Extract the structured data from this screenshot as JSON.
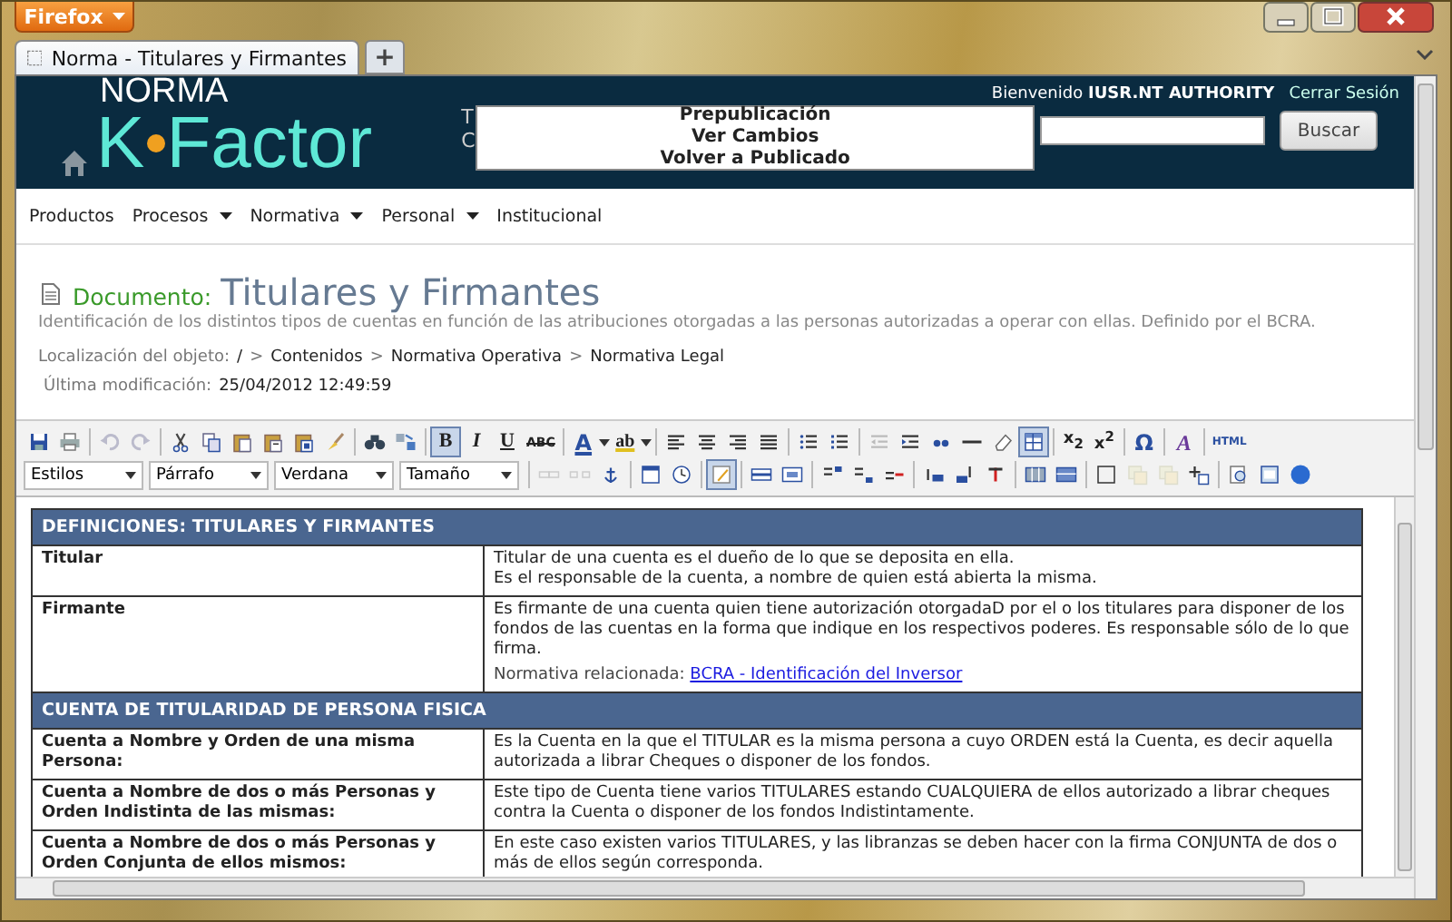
{
  "browser": {
    "menu_button": "Firefox",
    "tab_title": "Norma - Titulares y Firmantes",
    "new_tab": "+"
  },
  "header": {
    "logo_top": "NORMA",
    "logo_k": "K",
    "logo_rest": "Factor",
    "blurb": [
      "T",
      "C"
    ],
    "welcome": "Bienvenido",
    "user": "IUSR.NT AUTHORITY",
    "logout": "Cerrar Sesión",
    "search_button": "Buscar"
  },
  "popup": [
    "Prepublicación",
    "Ver Cambios",
    "Volver a Publicado"
  ],
  "nav": [
    {
      "label": "Productos",
      "has_menu": false
    },
    {
      "label": "Procesos",
      "has_menu": true
    },
    {
      "label": "Normativa",
      "has_menu": true
    },
    {
      "label": "Personal",
      "has_menu": true
    },
    {
      "label": "Institucional",
      "has_menu": false
    }
  ],
  "document": {
    "label": "Documento:",
    "title": "Titulares y Firmantes",
    "description": "Identificación de los distintos tipos de cuentas en función de las atribuciones otorgadas a las personas autorizadas a operar con ellas. Definido por el BCRA.",
    "location_label": "Localización del objeto:",
    "path": [
      "/",
      "Contenidos",
      "Normativa Operativa",
      "Normativa Legal"
    ],
    "separator": ">",
    "modified_label": "Última modificación:",
    "modified": "25/04/2012 12:49:59"
  },
  "editor": {
    "glyphs": [
      {
        "label": "B",
        "selected": true
      },
      {
        "label": "I",
        "selected": false
      },
      {
        "label": "U",
        "selected": false
      },
      {
        "label": "ABC",
        "selected": false
      },
      {
        "label": "A",
        "selected": false
      },
      {
        "label": "ab",
        "selected": false
      },
      {
        "label": "x$_{2}$",
        "selected": false
      },
      {
        "label": "x$^{2}$",
        "selected": false
      },
      {
        "label": "Ω",
        "selected": false
      },
      {
        "label": "A",
        "selected": false
      },
      {
        "label": "HTML",
        "selected": false
      }
    ],
    "table_button_selected": true,
    "edit_button_selected": true,
    "dropdowns": [
      "Estilos",
      "Párrafo",
      "Verdana",
      "Tamaño"
    ]
  },
  "table": {
    "sections": [
      {
        "heading": "DEFINICIONES: TITULARES Y FIRMANTES",
        "rows": [
          {
            "term": "Titular",
            "lines": [
              "Titular de una cuenta es el dueño de lo que se deposita en ella.",
              "Es el responsable de la cuenta, a nombre de quien está abierta la misma."
            ]
          },
          {
            "term": "Firmante",
            "lines": [
              "Es firmante de una cuenta quien tiene autorización otorgadaD por el o los titulares para disponer de los fondos de las cuentas en la forma que indique en los respectivos poderes. Es responsable sólo de lo que firma."
            ],
            "related_label": "Normativa relacionada:",
            "related_link": "BCRA - Identificación del Inversor"
          }
        ]
      },
      {
        "heading": "CUENTA DE TITULARIDAD DE PERSONA FISICA",
        "rows": [
          {
            "term": "Cuenta a Nombre y Orden de una misma Persona:",
            "lines": [
              "Es la Cuenta en la que el TITULAR es la misma persona a cuyo ORDEN está la Cuenta, es decir aquella autorizada a librar Cheques o disponer de los fondos."
            ]
          },
          {
            "term": "Cuenta a Nombre de dos o más Personas y Orden Indistinta de las mismas:",
            "lines": [
              "Este tipo de Cuenta tiene varios TITULARES estando CUALQUIERA de ellos autorizado a librar cheques contra la Cuenta o disponer de los fondos Indistintamente."
            ]
          },
          {
            "term": "Cuenta a Nombre de dos o más Personas y Orden Conjunta de ellos mismos:",
            "lines": [
              "En este caso existen varios TITULARES, y las libranzas se deben hacer con la firma CONJUNTA de dos o más de ellos según corresponda."
            ]
          }
        ]
      }
    ]
  }
}
